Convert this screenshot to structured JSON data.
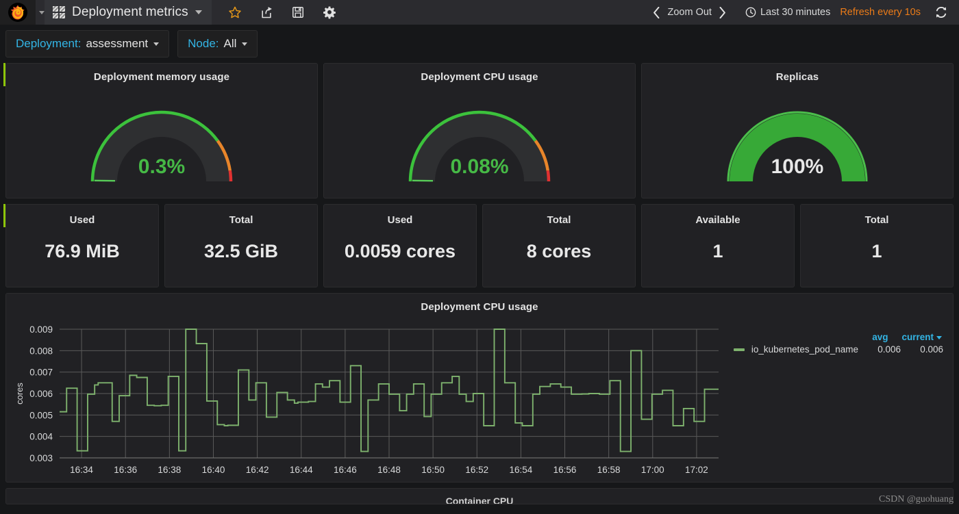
{
  "navbar": {
    "logo_alt": "grafana-logo",
    "dashboard_title": "Deployment metrics",
    "icons": [
      "star-icon",
      "share-icon",
      "save-icon",
      "settings-icon"
    ],
    "zoom_out_label": "Zoom Out",
    "time_range_label": "Last 30 minutes",
    "refresh_label": "Refresh every 10s",
    "refresh_color": "#eb7b18",
    "accent_blue": "#33b5e5"
  },
  "submenu": {
    "variables": [
      {
        "label": "Deployment:",
        "value": "assessment"
      },
      {
        "label": "Node:",
        "value": "All"
      }
    ]
  },
  "gauges": [
    {
      "title": "Deployment memory usage",
      "value_text": "0.3%",
      "value": 0.3,
      "min": 0,
      "max": 100,
      "value_color": "#46b946",
      "full_green": false
    },
    {
      "title": "Deployment CPU usage",
      "value_text": "0.08%",
      "value": 0.08,
      "min": 0,
      "max": 100,
      "value_color": "#46b946",
      "full_green": false
    },
    {
      "title": "Replicas",
      "value_text": "100%",
      "value": 100,
      "min": 0,
      "max": 100,
      "value_color": "#e8e8e8",
      "full_green": true
    }
  ],
  "stats": [
    {
      "title": "Used",
      "value": "76.9 MiB"
    },
    {
      "title": "Total",
      "value": "32.5 GiB"
    },
    {
      "title": "Used",
      "value": "0.0059 cores"
    },
    {
      "title": "Total",
      "value": "8 cores"
    },
    {
      "title": "Available",
      "value": "1"
    },
    {
      "title": "Total",
      "value": "1"
    }
  ],
  "partial_panel": {
    "title": "Container CPU"
  },
  "watermark": "CSDN @guohuang",
  "chart_data": {
    "type": "line",
    "title": "Deployment CPU usage",
    "ylabel": "cores",
    "xlabel": "",
    "ylim": [
      0.003,
      0.009
    ],
    "yticks": [
      "0.009",
      "0.008",
      "0.007",
      "0.006",
      "0.005",
      "0.004",
      "0.003"
    ],
    "ytick_values": [
      0.009,
      0.008,
      0.007,
      0.006,
      0.005,
      0.004,
      0.003
    ],
    "xticks": [
      "16:34",
      "16:36",
      "16:38",
      "16:40",
      "16:42",
      "16:44",
      "16:46",
      "16:48",
      "16:50",
      "16:52",
      "16:54",
      "16:56",
      "16:58",
      "17:00",
      "17:02"
    ],
    "grid": true,
    "legend_position": "right",
    "legend_columns": [
      "avg",
      "current"
    ],
    "series": [
      {
        "name": "io_kubernetes_pod_name",
        "color": "#7eb26d",
        "avg": "0.006",
        "current": "0.006",
        "values": [
          0.00515,
          0.00515,
          0.00625,
          0.00625,
          0.00625,
          0.00333,
          0.00333,
          0.00333,
          0.00597,
          0.00597,
          0.0064,
          0.0065,
          0.0065,
          0.0065,
          0.0065,
          0.0047,
          0.0047,
          0.0059,
          0.0059,
          0.0059,
          0.00685,
          0.00685,
          0.00675,
          0.00675,
          0.00675,
          0.00545,
          0.00545,
          0.00543,
          0.00543,
          0.00545,
          0.00545,
          0.0068,
          0.0068,
          0.0068,
          0.00333,
          0.00333,
          0.009,
          0.009,
          0.009,
          0.00833,
          0.00833,
          0.00833,
          0.00565,
          0.00565,
          0.00565,
          0.00455,
          0.00455,
          0.0045,
          0.00452,
          0.00452,
          0.00452,
          0.0071,
          0.0071,
          0.0071,
          0.0057,
          0.0057,
          0.0065,
          0.0065,
          0.0065,
          0.0049,
          0.0049,
          0.0049,
          0.00605,
          0.00605,
          0.00605,
          0.0057,
          0.0057,
          0.00555,
          0.0056,
          0.0056,
          0.0056,
          0.00563,
          0.00563,
          0.00645,
          0.00645,
          0.0063,
          0.0063,
          0.0066,
          0.0066,
          0.0066,
          0.0056,
          0.0056,
          0.0056,
          0.0073,
          0.0073,
          0.0073,
          0.0033,
          0.0033,
          0.0057,
          0.0057,
          0.0057,
          0.00645,
          0.00645,
          0.00645,
          0.00597,
          0.00597,
          0.00597,
          0.0052,
          0.0052,
          0.00597,
          0.00597,
          0.00645,
          0.00645,
          0.00645,
          0.00493,
          0.00493,
          0.00597,
          0.00597,
          0.00597,
          0.0065,
          0.0065,
          0.0065,
          0.0068,
          0.0068,
          0.00597,
          0.00597,
          0.00563,
          0.00563,
          0.006,
          0.006,
          0.006,
          0.0045,
          0.0045,
          0.0045,
          0.009,
          0.009,
          0.009,
          0.0065,
          0.0065,
          0.0065,
          0.00463,
          0.00463,
          0.0045,
          0.0045,
          0.0045,
          0.00597,
          0.00597,
          0.00633,
          0.00633,
          0.00633,
          0.00645,
          0.00645,
          0.00645,
          0.0063,
          0.0063,
          0.0063,
          0.00597,
          0.00597,
          0.00597,
          0.00598,
          0.00598,
          0.006,
          0.006,
          0.006,
          0.00597,
          0.00597,
          0.00597,
          0.0066,
          0.0066,
          0.0066,
          0.0033,
          0.0033,
          0.0033,
          0.008,
          0.008,
          0.008,
          0.0048,
          0.0048,
          0.0048,
          0.00597,
          0.00597,
          0.00597,
          0.00615,
          0.00615,
          0.00615,
          0.0045,
          0.0045,
          0.0045,
          0.0053,
          0.0053,
          0.0053,
          0.0047,
          0.0047,
          0.0047,
          0.0062,
          0.0062,
          0.0062,
          0.0062
        ]
      }
    ]
  }
}
